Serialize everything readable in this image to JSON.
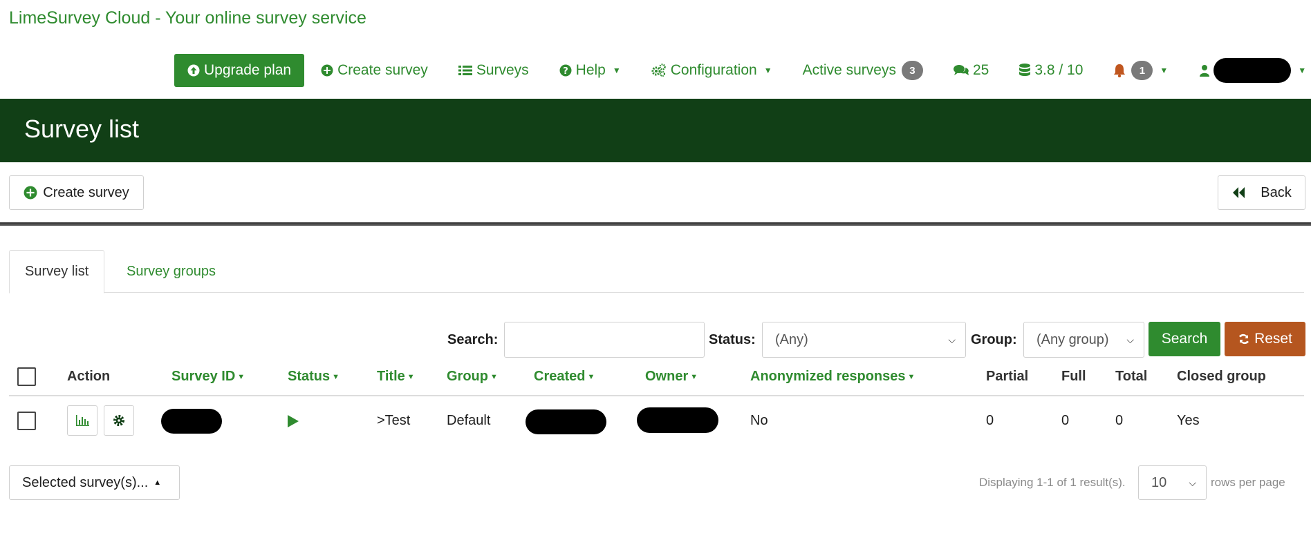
{
  "app": {
    "title": "LimeSurvey Cloud - Your online survey service"
  },
  "topnav": {
    "upgrade": "Upgrade plan",
    "create_survey": "Create survey",
    "surveys": "Surveys",
    "help": "Help",
    "configuration": "Configuration",
    "active_surveys": "Active surveys",
    "active_surveys_count": "3",
    "comments_count": "25",
    "storage": "3.8 / 10",
    "notifications_count": "1"
  },
  "banner": {
    "title": "Survey list"
  },
  "toolbar": {
    "create_survey": "Create survey",
    "back": "Back"
  },
  "tabs": [
    {
      "label": "Survey list"
    },
    {
      "label": "Survey groups"
    }
  ],
  "filters": {
    "search_label": "Search:",
    "search_value": "",
    "status_label": "Status:",
    "status_value": "(Any)",
    "group_label": "Group:",
    "group_value": "(Any group)",
    "search_button": "Search",
    "reset_button": "Reset"
  },
  "table": {
    "columns": [
      "Action",
      "Survey ID",
      "Status",
      "Title",
      "Group",
      "Created",
      "Owner",
      "Anonymized responses",
      "Partial",
      "Full",
      "Total",
      "Closed group"
    ],
    "rows": [
      {
        "title": ">Test",
        "group": "Default",
        "anonymized": "No",
        "partial": "0",
        "full": "0",
        "total": "0",
        "closed_group": "Yes"
      }
    ]
  },
  "footer": {
    "bulk_action": "Selected survey(s)...",
    "displaying": "Displaying 1-1 of 1 result(s).",
    "rows_per_page_value": "10",
    "rows_per_page_label": "rows per page"
  },
  "colors": {
    "brand_green": "#2f8b2f",
    "banner": "#113f16",
    "reset": "#b5561f",
    "badge": "#7a7a7a"
  }
}
